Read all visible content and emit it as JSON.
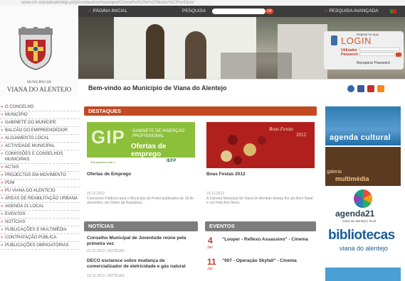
{
  "browser": {
    "url_text": "www.cm-vianadoalentejo.pt/pt/conteudos/municipio/Concelho%20e%20Munic%C3%ADpio/"
  },
  "topbar": {
    "home_label": "PÁGINA INICIAL",
    "search_label": "PESQUISA",
    "search_go": "OK",
    "advanced_search_label": "PESQUISA AVANÇADA"
  },
  "logo": {
    "small_text": "MUNICÍPIO DE",
    "big_text": "VIANA DO ALENTEJO"
  },
  "login": {
    "register_label": "Registe-se aqui",
    "title": "LOGIN",
    "user_label": "Utilizador",
    "password_label": "Password",
    "recover_label": "Recuperar Password"
  },
  "welcome": {
    "text": "Bem-vindo ao Município de Viana do Alentejo"
  },
  "social": [
    "share-icon",
    "facebook-icon",
    "youtube-icon",
    "rss-icon"
  ],
  "nav": {
    "items": [
      "O CONCELHO",
      "MUNICÍPIO",
      "GABINETE DO MUNÍCIPE",
      "BALCÃO DO EMPREENDEDOR",
      "ALOJAMENTO LOCAL",
      "ACTIVIDADE MUNICIPAL",
      "COMISSÕES E CONSELHOS MUNICIPAIS",
      "ACTAS",
      "PROJECTOS EM MOVIMENTO",
      "PDM",
      "PU VIANA DO ALENTEJO",
      "ÁREAS DE REABILITAÇÃO URBANA",
      "AGENDA 21 LOCAL",
      "EVENTOS",
      "NOTÍCIAS",
      "PUBLICAÇÕES E MULTIMÉDIA",
      "CONTRATAÇÃO PÚBLICA",
      "PUBLICAÇÕES OBRIGATÓRIAS"
    ]
  },
  "destaques": {
    "heading": "DESTAQUES",
    "cards": [
      {
        "image_big": "GIP",
        "image_sub": "GABINETE DE INSERÇÃO PROFISSIONAL",
        "image_offer": "Ofertas de emprego",
        "image_strip": "Em parceria com o",
        "image_partner": "IEFP",
        "title": "Ofertas de Emprego",
        "date": "19.12.2012",
        "text": "Concursos Públicos para o Município de Portel publicados de 18 de dezembro, em Diário da República..."
      },
      {
        "image_title": "Boas Festas",
        "image_year": "2012",
        "title": "Boas Festas 2012",
        "date": "19.12.2012",
        "text": "A Câmara Municipal de Viana do Alentejo deseja-lhe um Bom Natal e um Feliz Ano Novo."
      }
    ]
  },
  "noticias": {
    "heading": "NOTÍCIAS",
    "items": [
      {
        "title": "Conselho Municipal de Juventude reúne pela primeira vez",
        "meta": "21.12.2012 | NOTÍCIAS"
      },
      {
        "title": "DECO esclarece sobre mudança de comercializador de eletricidade e gás natural",
        "meta": "19.12.2012 | NOTÍCIAS"
      }
    ]
  },
  "eventos": {
    "heading": "EVENTOS",
    "items": [
      {
        "day": "4",
        "month": "Jan",
        "title": "\"Looper - Reflexo Assassino\" - Cinema"
      },
      {
        "day": "11",
        "month": "Jan",
        "title": "\"007 - Operação Skyfall\" - Cinema"
      }
    ]
  },
  "banners": {
    "agenda": "agenda cultural",
    "galeria": "galeria",
    "multimedia": "multimédia",
    "a21_label": "agenda21",
    "a21_sub": "viana do alentejo | local",
    "biblio_label": "bibliotecas",
    "biblio_sub": "viana do alentejo"
  },
  "colors": {
    "accent": "#c24a22",
    "section_grey": "#7d7d7d",
    "topbar": "#3c3c3c"
  }
}
